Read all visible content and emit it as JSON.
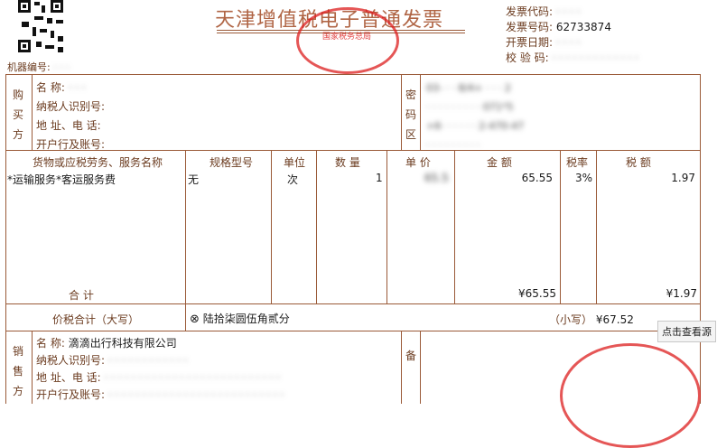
{
  "invoice": {
    "title": "天津增值税电子普通发票",
    "header_fields": [
      {
        "label": "发票代码:",
        "value": ""
      },
      {
        "label": "发票号码:",
        "value": "62733874"
      },
      {
        "label": "开票日期:",
        "value": ""
      },
      {
        "label": "校 验 码:",
        "value": ""
      }
    ],
    "machine_no_label": "机器编号:",
    "seal_text": "国家税务总局"
  },
  "buyer": {
    "section": [
      "购",
      "买",
      "方"
    ],
    "labels": [
      "名      称:",
      "纳税人识别号:",
      "地 址、电 话:",
      "开户行及账号:"
    ]
  },
  "cipher": {
    "section": [
      "密",
      "码",
      "区"
    ],
    "lines": [
      "03-  ·  ·  8/4+    ·  ·  ·  2",
      "·  ·  ·  ·  ·  ·  ·  ·  ·  071*5",
      "+6·  ·  ·  ·  ·  ·  2-470-47",
      "·  ·  ·  ·  ·  ·  ·  ·  ·"
    ]
  },
  "items_table": {
    "headers": [
      "货物或应税劳务、服务名称",
      "规格型号",
      "单位",
      "数  量",
      "单  价",
      "金  额",
      "税率",
      "税  额"
    ],
    "row": {
      "name": "*运输服务*客运服务费",
      "spec": "无",
      "unit": "次",
      "qty": "1",
      "price": "65.5",
      "amount": "65.55",
      "rate": "3%",
      "tax": "1.97"
    },
    "total_label": "合      计",
    "total_amount": "¥65.55",
    "total_tax": "¥1.97"
  },
  "grand_total": {
    "label": "价税合计（大写）",
    "symbol": "⊗",
    "uppercase": "陆拾柒圆伍角贰分",
    "small_label": "（小写）",
    "small_value": "¥67.52"
  },
  "seller": {
    "section": [
      "销",
      "售",
      "方"
    ],
    "labels": [
      "名      称:",
      "纳税人识别号:",
      "地 址、电 话:",
      "开户行及账号:"
    ],
    "name": "滴滴出行科技有限公司"
  },
  "notes": {
    "label": "备"
  },
  "tooltip": "点击查看源"
}
